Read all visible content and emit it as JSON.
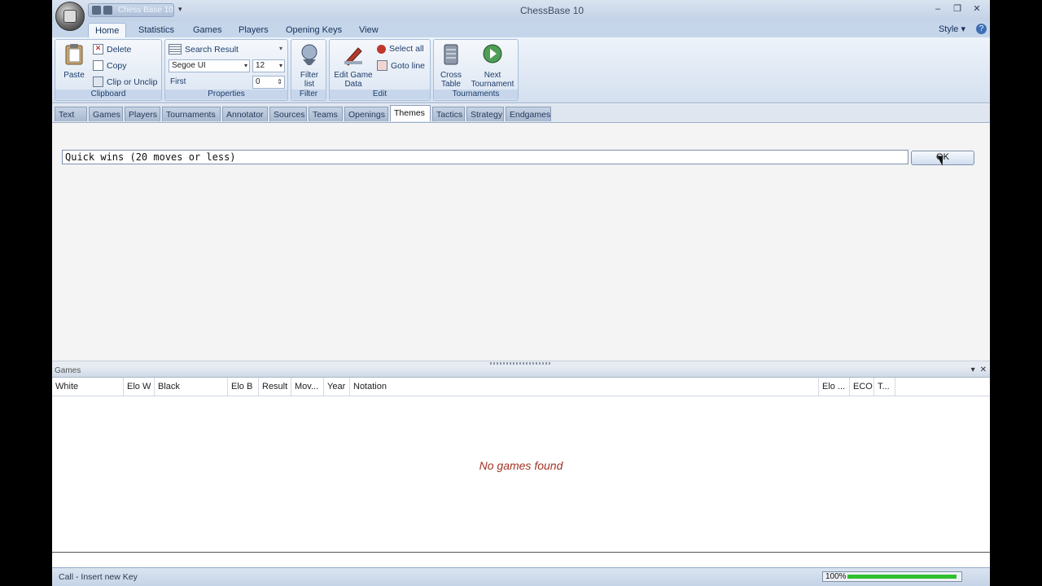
{
  "window": {
    "title": "ChessBase 10",
    "qat_label": "Chess Base 10"
  },
  "ribbon_tabs": [
    "Home",
    "Statistics",
    "Games",
    "Players",
    "Opening Keys",
    "View"
  ],
  "active_ribbon_tab": "Home",
  "style_menu": "Style",
  "ribbon": {
    "clipboard": {
      "label": "Clipboard",
      "paste": "Paste",
      "delete": "Delete",
      "copy": "Copy",
      "clip_or_unclip": "Clip or Unclip"
    },
    "properties": {
      "label": "Properties",
      "search_result": "Search Result",
      "font_name": "Segoe UI",
      "font_size": "12",
      "first_label": "First",
      "first_value": "0"
    },
    "filter": {
      "label": "Filter",
      "filter_list_line1": "Filter",
      "filter_list_line2": "list"
    },
    "edit": {
      "label": "Edit",
      "edit_game_data_line1": "Edit Game",
      "edit_game_data_line2": "Data",
      "select_all": "Select all",
      "goto_line": "Goto line"
    },
    "tournaments": {
      "label": "Tournaments",
      "cross_table_line1": "Cross",
      "cross_table_line2": "Table",
      "next_tournament_line1": "Next",
      "next_tournament_line2": "Tournament"
    }
  },
  "sub_tabs": [
    "Text",
    "Games",
    "Players",
    "Tournaments",
    "Annotator",
    "Sources",
    "Teams",
    "Openings",
    "Themes",
    "Tactics",
    "Strategy",
    "Endgames"
  ],
  "active_sub_tab": "Themes",
  "query": {
    "value": "Quick wins (20 moves or less)",
    "ok_label": "OK"
  },
  "games_pane": {
    "title": "Games",
    "columns": [
      "White",
      "Elo W",
      "Black",
      "Elo B",
      "Result",
      "Mov...",
      "Year",
      "Notation",
      "Elo ...",
      "ECO",
      "T..."
    ],
    "empty_message": "No games found"
  },
  "status": {
    "text": "Call - Insert new Key",
    "zoom": "100%",
    "progress_fraction": 1.0
  },
  "colors": {
    "accent": "#1e3d6b",
    "empty_message": "#a33326",
    "progress": "#2fbf2f"
  }
}
